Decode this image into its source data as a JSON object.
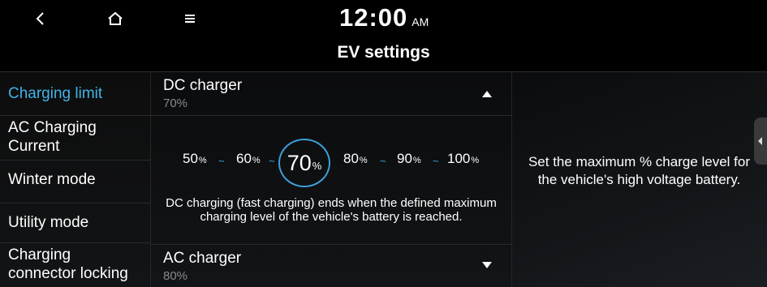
{
  "topbar": {
    "back_icon": "chevron-left-icon",
    "home_icon": "home-icon",
    "menu_icon": "hamburger-menu-icon",
    "time": "12:00",
    "ampm": "AM"
  },
  "page": {
    "title": "EV settings"
  },
  "sidebar": {
    "items": [
      {
        "label": "Charging limit",
        "active": true
      },
      {
        "label": "AC Charging\nCurrent"
      },
      {
        "label": "Winter mode"
      },
      {
        "label": "Utility mode"
      },
      {
        "label": "Charging\nconnector locking"
      }
    ]
  },
  "dc_section": {
    "title": "DC charger",
    "value": "70%",
    "expanded": true,
    "levels": [
      "50",
      "60",
      "70",
      "80",
      "90",
      "100"
    ],
    "selected": "70",
    "unit": "%",
    "description": "DC charging (fast charging) ends when the defined maximum charging level of the vehicle's battery is reached."
  },
  "ac_section": {
    "title": "AC charger",
    "value": "80%",
    "expanded": false
  },
  "info_panel": {
    "text": "Set the maximum % charge level for the vehicle's high voltage battery."
  },
  "colors": {
    "accent": "#3fb4e6",
    "background": "#000000",
    "muted_text": "#8a8a8a"
  }
}
